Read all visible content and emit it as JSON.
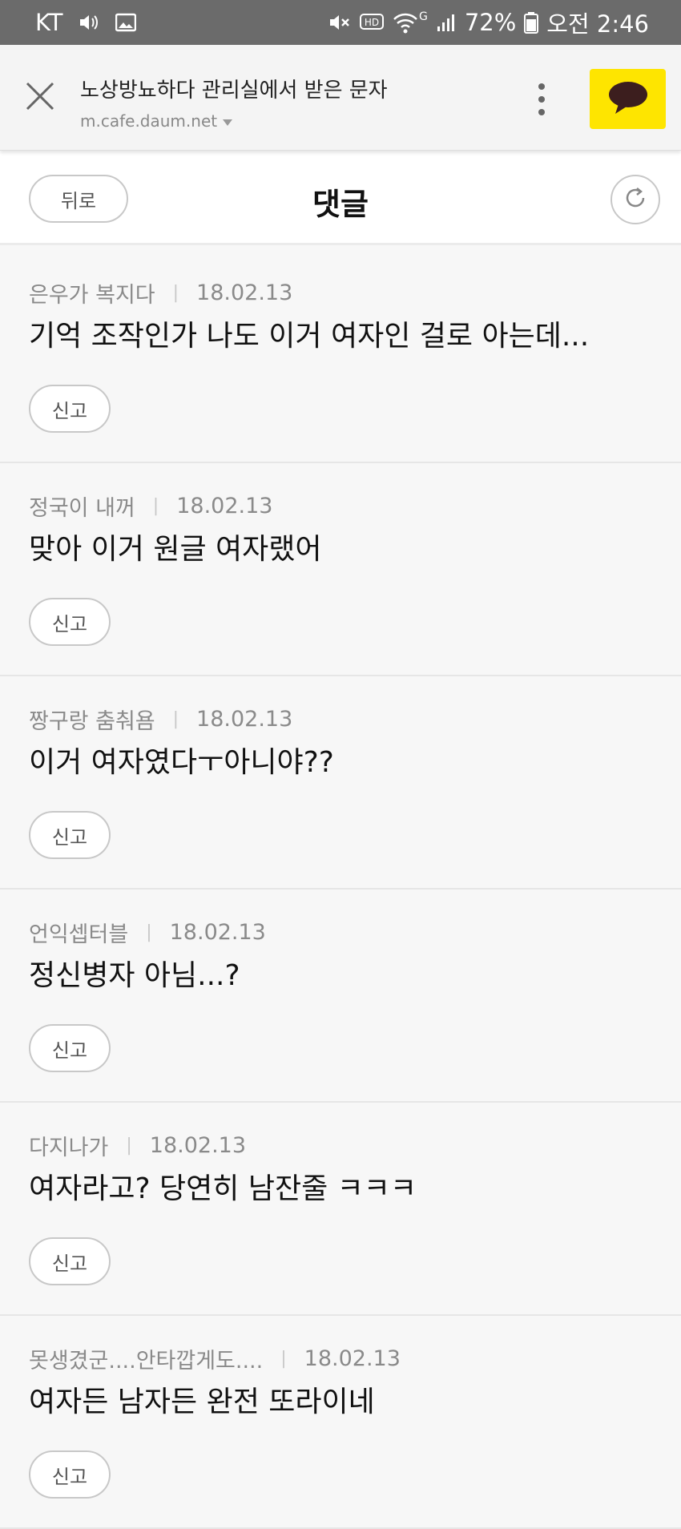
{
  "status_bar": {
    "carrier": "KT",
    "network": "G",
    "battery": "72%",
    "time": "오전 2:46",
    "icons": [
      "volume-icon",
      "image-icon",
      "mute-icon",
      "hd-icon",
      "wifi-icon",
      "signal-icon",
      "battery-icon"
    ]
  },
  "browser": {
    "page_title": "노상방뇨하다 관리실에서 받은 문자",
    "url": "m.cafe.daum.net",
    "accent_color": "#fee500"
  },
  "header": {
    "back_label": "뒤로",
    "title": "댓글"
  },
  "comments": [
    {
      "author": "은우가 복지다",
      "date": "18.02.13",
      "text": "기억 조작인가 나도 이거 여자인 걸로 아는데...",
      "report_label": "신고"
    },
    {
      "author": "정국이 내꺼",
      "date": "18.02.13",
      "text": "맞아 이거 원글 여자랬어",
      "report_label": "신고"
    },
    {
      "author": "짱구랑 춤춰욤",
      "date": "18.02.13",
      "text": "이거 여자였다ㅜ아니야??",
      "report_label": "신고"
    },
    {
      "author": "언익셉터블",
      "date": "18.02.13",
      "text": "정신병자 아님...?",
      "report_label": "신고"
    },
    {
      "author": "다지나가",
      "date": "18.02.13",
      "text": "여자라고? 당연히 남잔줄 ㅋㅋㅋ",
      "report_label": "신고"
    },
    {
      "author": "못생겼군....안타깝게도....",
      "date": "18.02.13",
      "text": "여자든 남자든 완전 또라이네",
      "report_label": "신고"
    }
  ]
}
